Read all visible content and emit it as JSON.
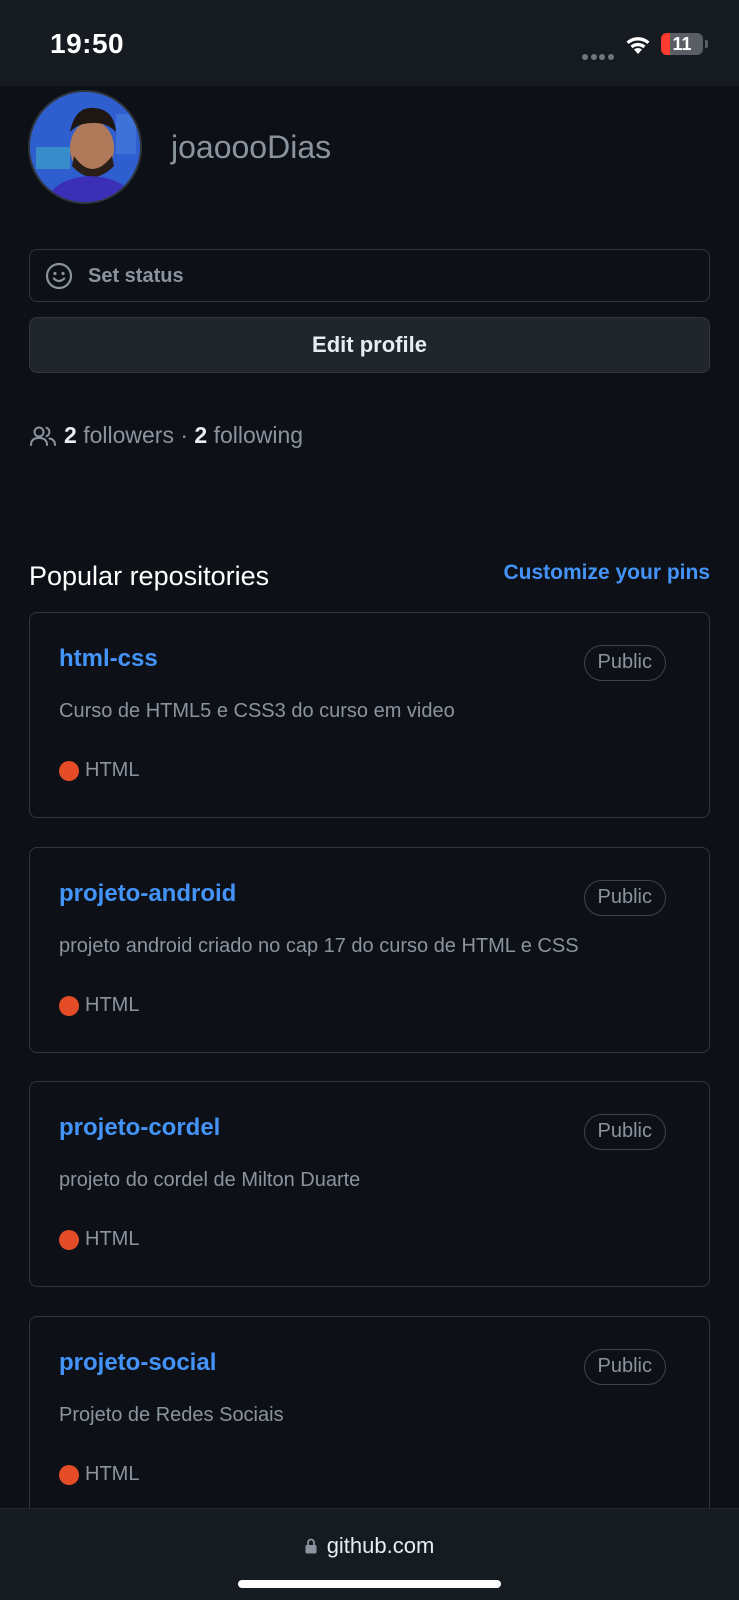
{
  "status_bar": {
    "time": "19:50",
    "battery_level": "11"
  },
  "profile": {
    "username": "joaoooDias",
    "set_status_label": "Set status",
    "edit_profile_label": "Edit profile",
    "followers_count": "2",
    "followers_label": "followers",
    "separator": "·",
    "following_count": "2",
    "following_label": "following"
  },
  "popular": {
    "title": "Popular repositories",
    "customize_label": "Customize your pins",
    "repos": [
      {
        "name": "html-css",
        "visibility": "Public",
        "description": "Curso de HTML5 e CSS3 do curso em video",
        "language": "HTML",
        "language_color": "#e34c26"
      },
      {
        "name": "projeto-android",
        "visibility": "Public",
        "description": "projeto android criado no cap 17 do curso de HTML e CSS",
        "language": "HTML",
        "language_color": "#e34c26"
      },
      {
        "name": "projeto-cordel",
        "visibility": "Public",
        "description": "projeto do cordel de Milton Duarte",
        "language": "HTML",
        "language_color": "#e34c26"
      },
      {
        "name": "projeto-social",
        "visibility": "Public",
        "description": "Projeto de Redes Sociais",
        "language": "HTML",
        "language_color": "#e34c26"
      }
    ]
  },
  "browser": {
    "url": "github.com",
    "icons": [
      "lock-icon"
    ]
  },
  "colors": {
    "background": "#0d1117",
    "link": "#4493f8",
    "muted": "#8b949e",
    "border": "#30363d"
  }
}
